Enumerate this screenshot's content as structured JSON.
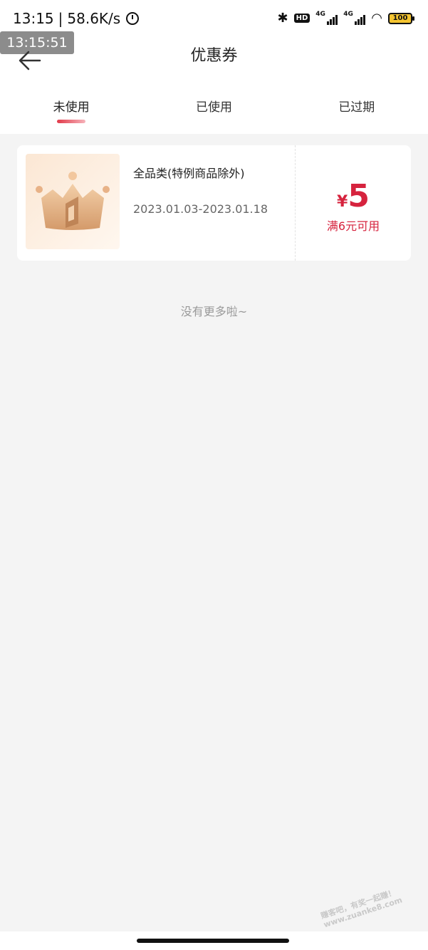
{
  "status_bar": {
    "time": "13:15",
    "separator": "|",
    "speed": "58.6K/s",
    "hd": "HD",
    "network_1": "4G",
    "network_2": "4G",
    "battery": "100"
  },
  "overlay_time": "13:15:51",
  "header": {
    "title": "优惠券"
  },
  "tabs": [
    {
      "label": "未使用",
      "active": true
    },
    {
      "label": "已使用",
      "active": false
    },
    {
      "label": "已过期",
      "active": false
    }
  ],
  "coupon": {
    "description": "全品类(特例商品除外)",
    "validity": "2023.01.03-2023.01.18",
    "currency": "¥",
    "amount": "5",
    "condition": "满6元可用"
  },
  "footer_text": "没有更多啦~",
  "watermark": {
    "line1": "赚客吧，有奖一起赚！",
    "line2": "www.zuanke8.com"
  },
  "colors": {
    "accent": "#d6233e",
    "background": "#f4f4f4"
  }
}
